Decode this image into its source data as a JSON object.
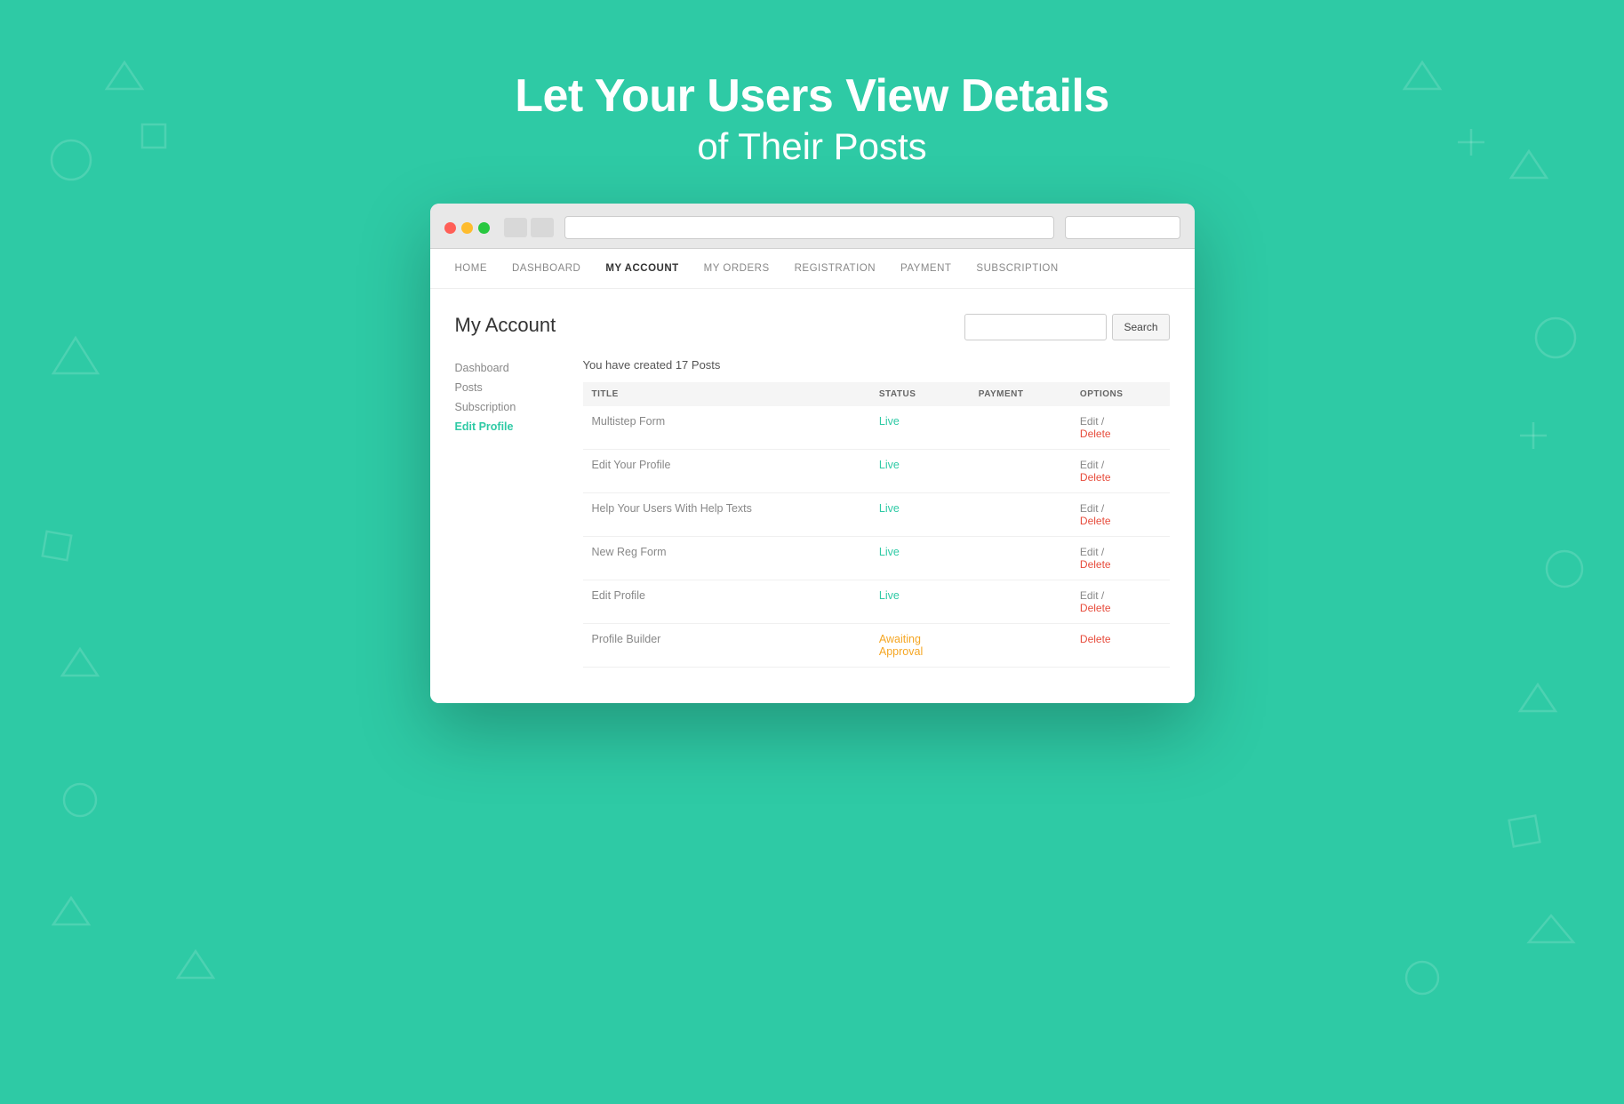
{
  "hero": {
    "title": "Let Your Users View Details",
    "subtitle": "of Their Posts"
  },
  "browser": {
    "dots": [
      "red",
      "yellow",
      "green"
    ]
  },
  "nav": {
    "items": [
      {
        "label": "HOME",
        "active": false
      },
      {
        "label": "DASHBOARD",
        "active": false
      },
      {
        "label": "MY ACCOUNT",
        "active": true
      },
      {
        "label": "MY ORDERS",
        "active": false
      },
      {
        "label": "REGISTRATION",
        "active": false
      },
      {
        "label": "PAYMENT",
        "active": false
      },
      {
        "label": "SUBSCRIPTION",
        "active": false
      }
    ]
  },
  "page": {
    "title": "My Account",
    "search_placeholder": "",
    "search_button": "Search"
  },
  "sidebar": {
    "items": [
      {
        "label": "Dashboard",
        "active": false
      },
      {
        "label": "Posts",
        "active": false
      },
      {
        "label": "Subscription",
        "active": false
      },
      {
        "label": "Edit Profile",
        "active": true
      }
    ]
  },
  "posts": {
    "count_text": "You have created 17 Posts",
    "columns": [
      "TITLE",
      "STATUS",
      "PAYMENT",
      "OPTIONS"
    ],
    "rows": [
      {
        "title": "Multistep Form",
        "status": "Live",
        "status_type": "live",
        "payment": "",
        "edit": "Edit /",
        "delete": "Delete"
      },
      {
        "title": "Edit Your Profile",
        "status": "Live",
        "status_type": "live",
        "payment": "",
        "edit": "Edit /",
        "delete": "Delete"
      },
      {
        "title": "Help Your Users With Help Texts",
        "status": "Live",
        "status_type": "live",
        "payment": "",
        "edit": "Edit /",
        "delete": "Delete"
      },
      {
        "title": "New Reg Form",
        "status": "Live",
        "status_type": "live",
        "payment": "",
        "edit": "Edit /",
        "delete": "Delete"
      },
      {
        "title": "Edit Profile",
        "status": "Live",
        "status_type": "live",
        "payment": "",
        "edit": "Edit /",
        "delete": "Delete"
      },
      {
        "title": "Profile Builder",
        "status": "Awaiting\nApproval",
        "status_type": "awaiting",
        "payment": "",
        "edit": "",
        "delete": "Delete"
      }
    ]
  }
}
